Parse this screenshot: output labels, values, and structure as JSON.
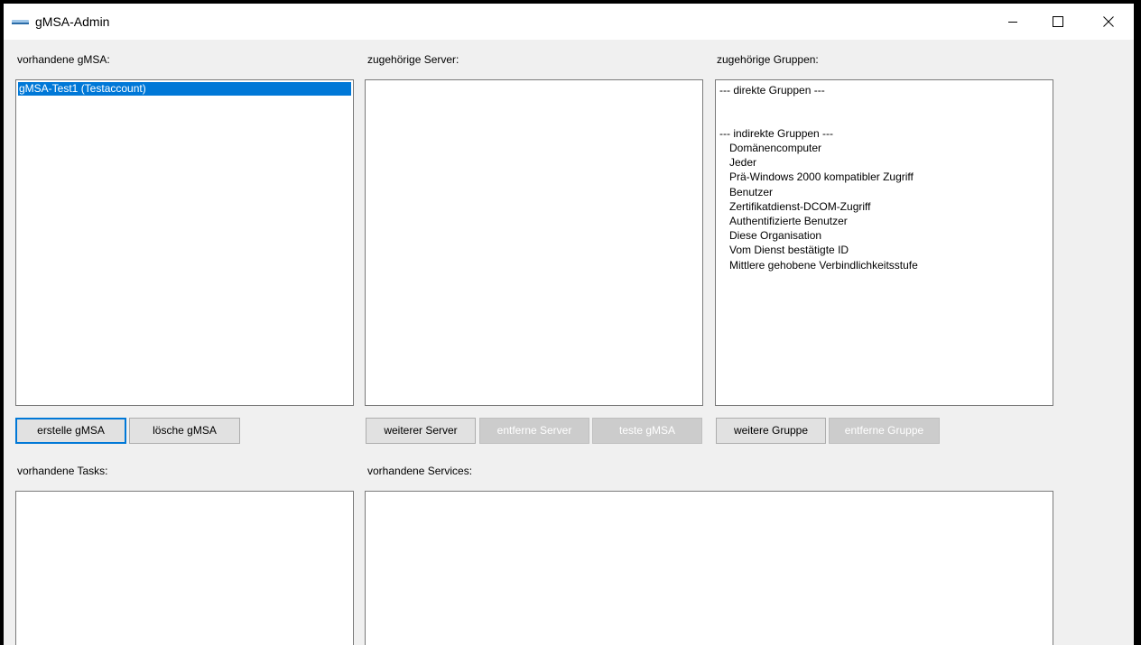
{
  "window": {
    "title": "gMSA-Admin",
    "controls": {
      "minimize_icon": "minimize-icon",
      "maximize_icon": "maximize-icon",
      "close_icon": "close-icon"
    }
  },
  "gmsa": {
    "label": "vorhandene gMSA:",
    "items": [
      "gMSA-Test1 (Testaccount)"
    ],
    "selected_index": 0,
    "create_label": "erstelle gMSA",
    "delete_label": "lösche gMSA"
  },
  "servers": {
    "label": "zugehörige Server:",
    "items": [],
    "add_label": "weiterer Server",
    "remove_label": "entferne Server",
    "test_label": "teste gMSA"
  },
  "groups": {
    "label": "zugehörige Gruppen:",
    "direct_header": "--- direkte Gruppen ---",
    "indirect_header": "--- indirekte Gruppen ---",
    "indirect_items": [
      "Domänencomputer",
      "Jeder",
      "Prä-Windows 2000 kompatibler Zugriff",
      "Benutzer",
      "Zertifikatdienst-DCOM-Zugriff",
      "Authentifizierte Benutzer",
      "Diese Organisation",
      "Vom Dienst bestätigte ID",
      "Mittlere gehobene Verbindlichkeitsstufe"
    ],
    "add_label": "weitere Gruppe",
    "remove_label": "entferne Gruppe"
  },
  "tasks": {
    "label": "vorhandene Tasks:",
    "items": []
  },
  "services": {
    "label": "vorhandene Services:",
    "items": []
  },
  "colors": {
    "selection": "#0078d7",
    "window_bg": "#f0f0f0",
    "titlebar_bg": "#ffffff"
  }
}
